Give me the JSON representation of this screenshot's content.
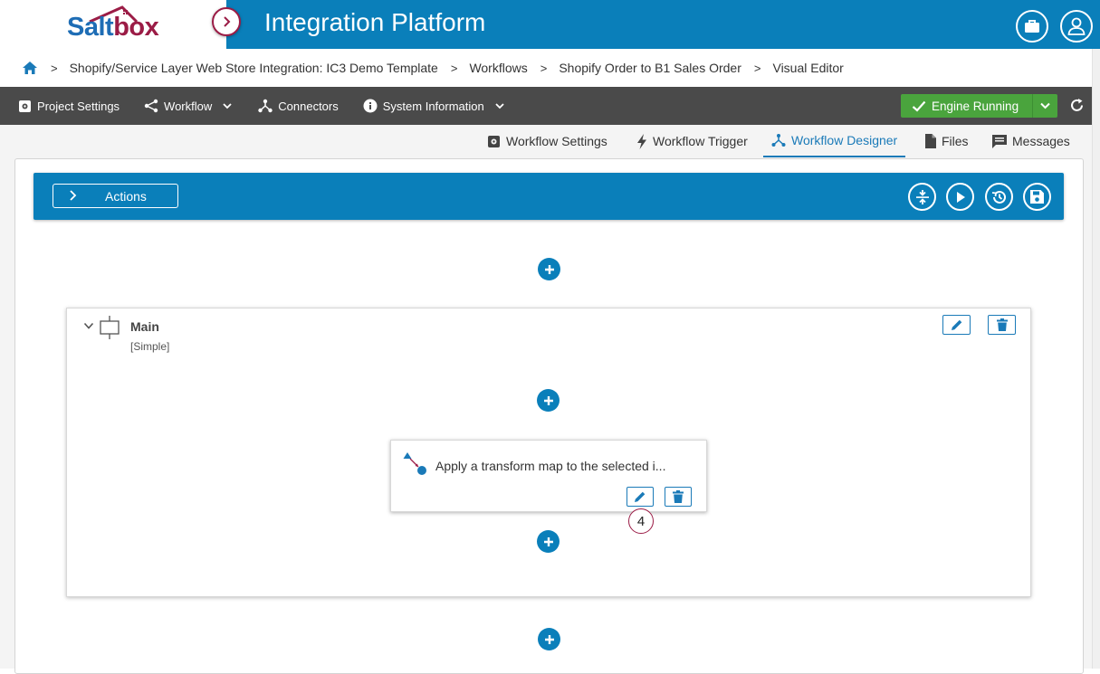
{
  "header": {
    "logo_text_1": "Salt",
    "logo_text_2": "box",
    "title": "Integration Platform",
    "icons": [
      "briefcase-icon",
      "user-icon"
    ]
  },
  "breadcrumb": {
    "items": [
      "Shopify/Service Layer Web Store Integration: IC3 Demo Template",
      "Workflows",
      "Shopify Order to B1 Sales Order",
      "Visual Editor"
    ]
  },
  "navbar": {
    "project_settings": "Project Settings",
    "workflow": "Workflow",
    "connectors": "Connectors",
    "system_information": "System Information",
    "engine_status": "Engine Running"
  },
  "subtabs": {
    "workflow_settings": "Workflow Settings",
    "workflow_trigger": "Workflow Trigger",
    "workflow_designer": "Workflow Designer",
    "files": "Files",
    "messages": "Messages",
    "active": "Workflow Designer"
  },
  "designer": {
    "actions_label": "Actions",
    "group": {
      "title": "Main",
      "subtitle": "[Simple]"
    },
    "step": {
      "description": "Apply a transform map to the selected i..."
    },
    "badge_number": "4"
  },
  "colors": {
    "brand_blue": "#0a7fba",
    "brand_red": "#9b1c46",
    "engine_green": "#4aa43d",
    "navbar_gray": "#4a4a4a"
  }
}
